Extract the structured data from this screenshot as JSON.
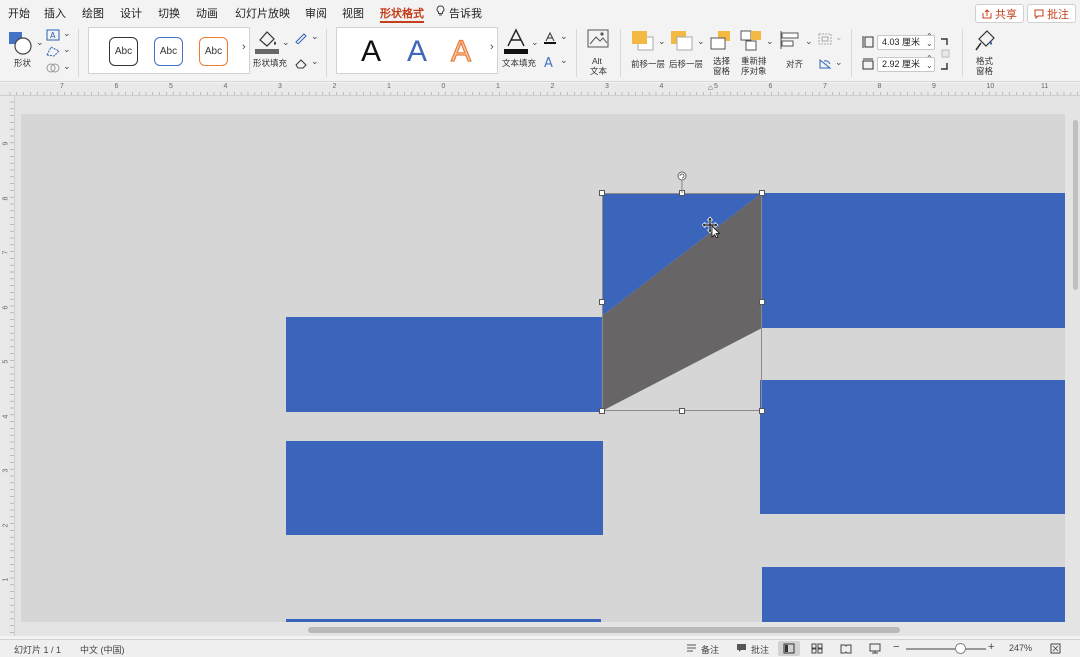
{
  "menu": {
    "tabs": [
      "开始",
      "插入",
      "绘图",
      "设计",
      "切换",
      "动画",
      "幻灯片放映",
      "审阅",
      "视图",
      "形状格式"
    ],
    "tell_me": "告诉我",
    "share": "共享",
    "comments": "批注"
  },
  "ribbon": {
    "shapes_label": "形状",
    "style_samples": [
      "Abc",
      "Abc",
      "Abc"
    ],
    "shape_fill_label": "形状填充",
    "wordart_samples": [
      "A",
      "A",
      "A"
    ],
    "text_fill_label": "文本填充",
    "alt_text_label_1": "Alt",
    "alt_text_label_2": "文本",
    "bring_forward": "前移一层",
    "send_backward": "后移一层",
    "selection_pane_1": "选择",
    "selection_pane_2": "窗格",
    "reorder_1": "重新排",
    "reorder_2": "序对象",
    "align": "对齐",
    "height_value": "4.03 厘米",
    "width_value": "2.92 厘米",
    "format_pane_1": "格式",
    "format_pane_2": "窗格"
  },
  "ruler": {
    "h_labels": [
      "7",
      "6",
      "5",
      "4",
      "3",
      "2",
      "1",
      "0",
      "1",
      "2",
      "3",
      "4",
      "5",
      "6",
      "7",
      "8",
      "9",
      "10",
      "11"
    ],
    "v_labels": [
      "9",
      "8",
      "7",
      "6",
      "5",
      "4",
      "3",
      "2",
      "1"
    ]
  },
  "status": {
    "slide_count": "幻灯片 1 / 1",
    "language": "中文 (中国)",
    "notes": "备注",
    "comments": "批注",
    "zoom": "247%"
  },
  "colors": {
    "accent": "#c43e1c",
    "shape_blue": "#3b65bb",
    "shape_gray": "#686566",
    "slide_bg": "#d6d6d6"
  }
}
